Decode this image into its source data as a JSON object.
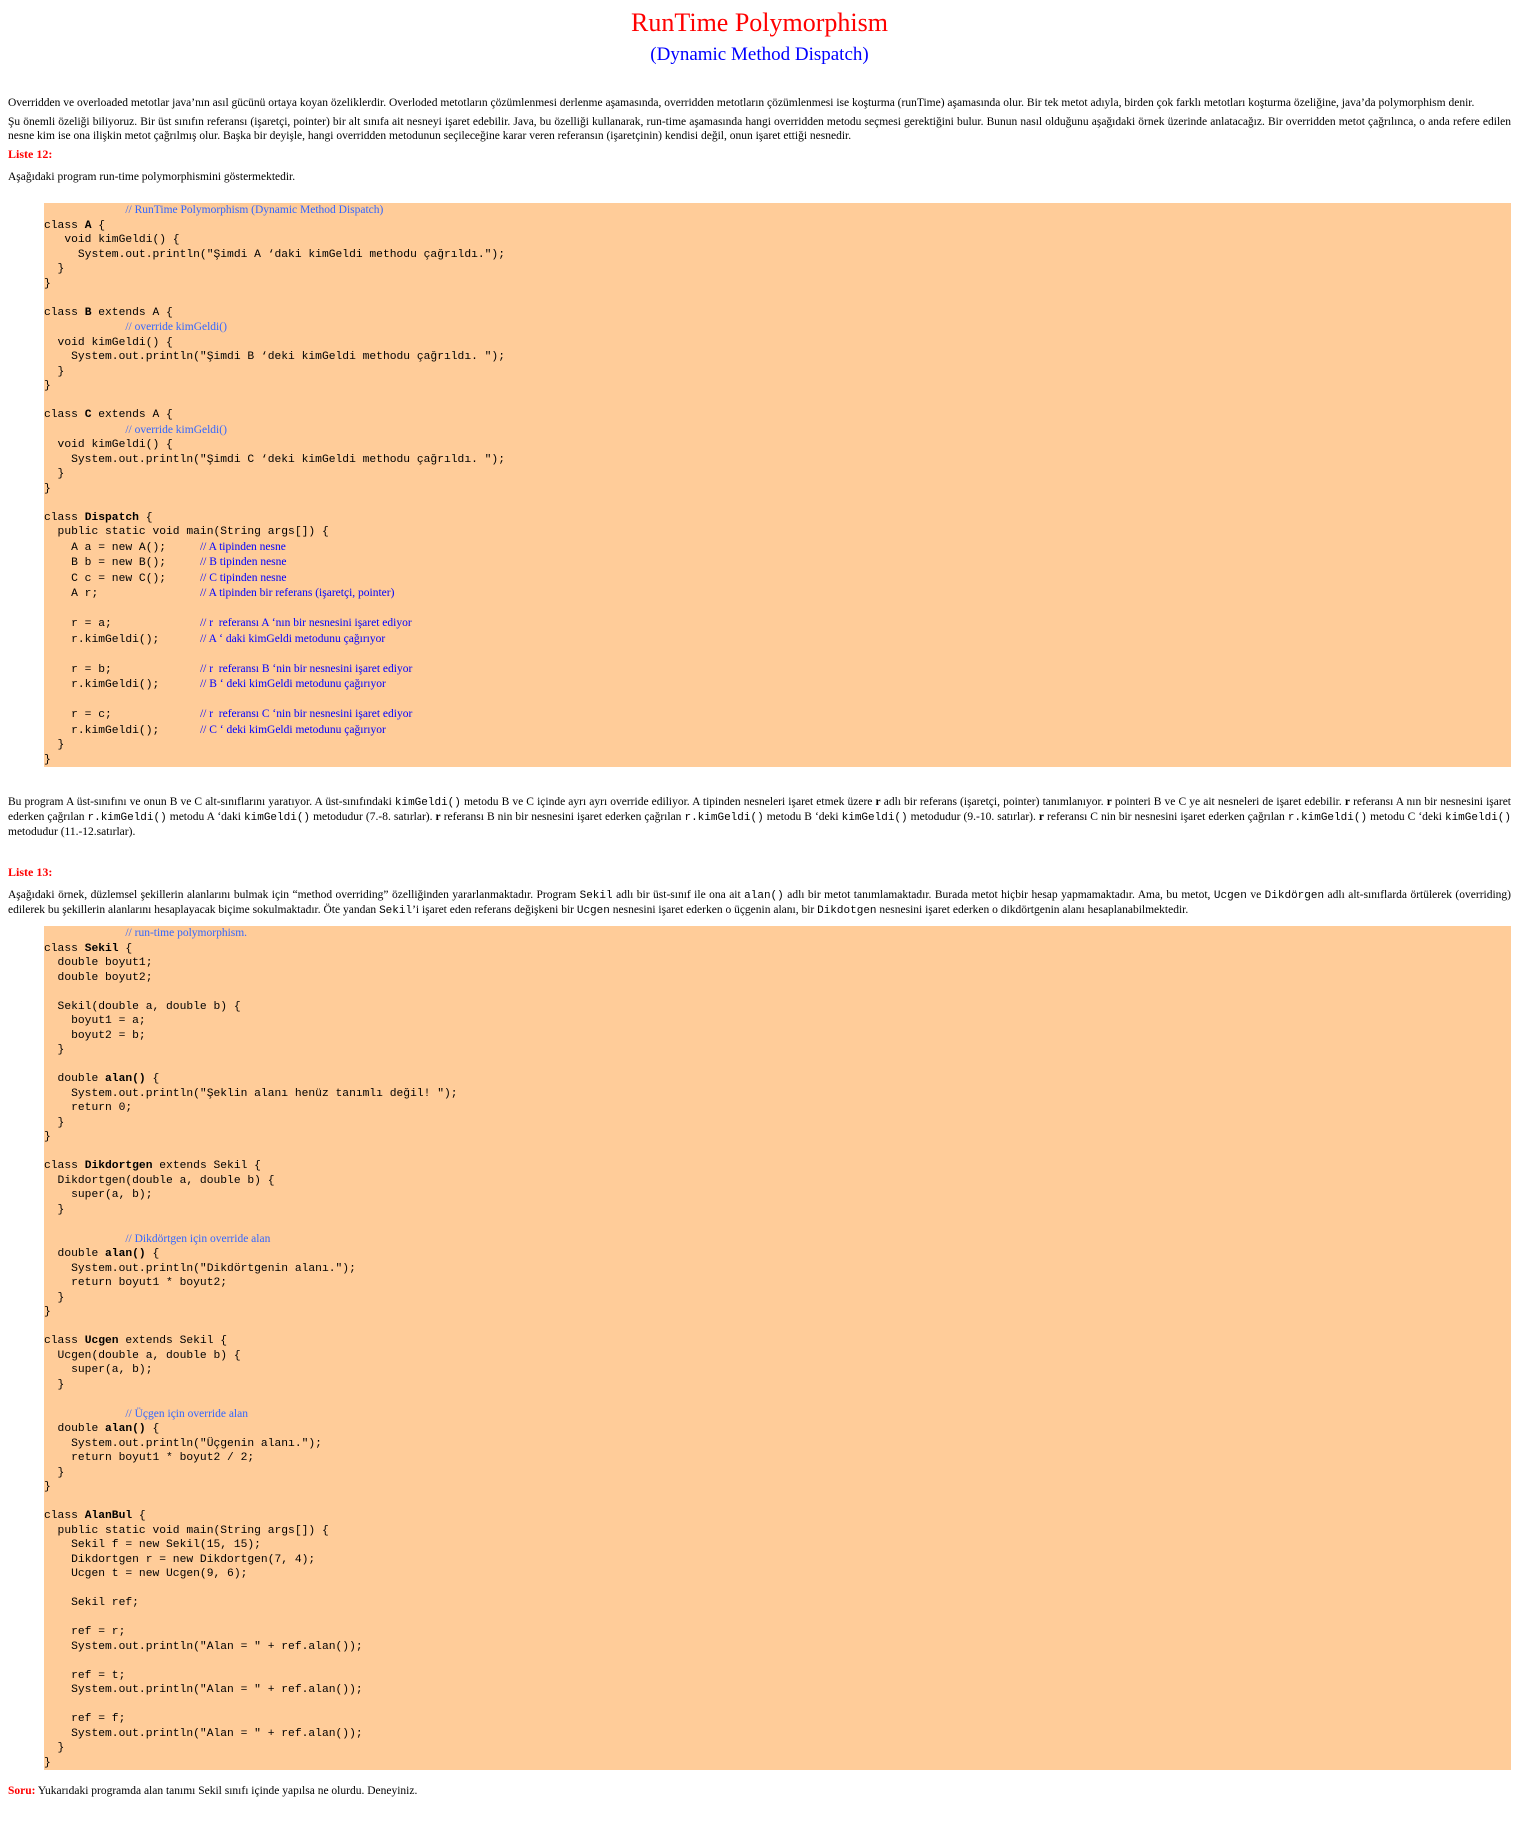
{
  "title": "RunTime Polymorphism",
  "subtitle": "(Dynamic Method Dispatch)",
  "intro": {
    "p1": "Overridden ve overloaded metotlar java’nın asıl gücünü ortaya koyan özeliklerdir. Overloded metotların çözümlenmesi derlenme aşamasında,  overridden metotların çözümlenmesi ise koşturma (runTime) aşamasında olur. Bir tek metot adıyla, birden çok farklı  metotları koşturma özeliğine, java’da polymorphism denir.",
    "p2": "Şu önemli özeliği biliyoruz. Bir üst sınıfın referansı (işaretçi, pointer) bir alt sınıfa ait nesneyi işaret edebilir. Java, bu özelliği kullanarak, run-time aşamasında hangi overridden metodu seçmesi gerektiğini bulur. Bunun nasıl olduğunu aşağıdaki örnek üzerinde anlatacağız. Bir overridden metot çağrılınca, o anda refere edilen nesne kim ise ona ilişkin metot çağrılmış olur. Başka bir deyişle, hangi overridden metodunun seçileceğine karar veren referansın (işaretçinin) kendisi değil, onun işaret ettiği nesnedir."
  },
  "liste12": {
    "label": "Liste 12:",
    "desc": "Aşağıdaki program run-time polymorphismini göstermektedir.",
    "header_comment": "// RunTime Polymorphism (Dynamic Method Dispatch)",
    "override_comment": "// override kimGeldi()",
    "main_comments": [
      "// A tipinden nesne",
      "// B tipinden nesne",
      "// C tipinden nesne",
      "// A tipinden bir referans (işaretçi, pointer)",
      "// r  referansı A ‘nın bir nesnesini işaret ediyor",
      "// A ‘ daki kimGeldi metodunu çağırıyor",
      "// r  referansı B ‘nin bir nesnesini işaret ediyor",
      "// B ‘ deki kimGeldi metodunu çağırıyor",
      "// r  referansı C ‘nin bir nesnesini işaret ediyor",
      "// C ‘ deki kimGeldi metodunu çağırıyor"
    ]
  },
  "explain12": {
    "t1": "Bu program A üst-sınıfını ve onun B ve C alt-sınıflarını yaratıyor. A üst-sınıfındaki ",
    "c1": "kimGeldi()",
    "t2": " metodu B ve C içinde ayrı ayrı override ediliyor. A tipinden nesneleri işaret etmek üzere ",
    "b1": "r",
    "t3": " adlı bir referans (işaretçi, pointer) tanımlanıyor. ",
    "b2": "r",
    "t4": " pointeri B ve C ye ait nesneleri de işaret edebilir. ",
    "b3": "r",
    "t5": " referansı A nın bir nesnesini işaret ederken çağrılan ",
    "c2": "r.kimGeldi()",
    "t6": " metodu A ‘daki ",
    "c3": "kimGeldi()",
    "t7": " metodudur (7.-8. satırlar). ",
    "b4": "r",
    "t8": " referansı B nin bir nesnesini işaret ederken çağrılan ",
    "c4": "r.kimGeldi()",
    "t9": " metodu B ‘deki ",
    "c5": "kimGeldi()",
    "t10": " metodudur (9.-10. satırlar). ",
    "b5": "r",
    "t11": " referansı C nin bir nesnesini işaret ederken çağrılan ",
    "c6": "r.kimGeldi()",
    "t12": " metodu C ‘deki  ",
    "c7": "kimGeldi()",
    "t13": " metodudur (11.-12.satırlar)."
  },
  "liste13": {
    "label": "Liste 13:",
    "d1": "Aşağıdaki örnek, düzlemsel şekillerin alanlarını bulmak için “method overriding” özelliğinden yararlanmaktadır. Program ",
    "dc1": "Sekil",
    "d2": " adlı bir üst-sınıf  ile ona ait ",
    "dc2": "alan()",
    "d3": " adlı bir metot tanımlamaktadır. Burada metot hiçbir hesap yapmamaktadır. Ama, bu metot, ",
    "dc3": "Ucgen",
    "d4": " ve ",
    "dc4": "Dikdörgen",
    "d5": " adlı alt-sınıflarda örtülerek (overriding) edilerek bu şekillerin alanlarını hesaplayacak biçime sokulmaktadır. Öte  yandan ",
    "dc5": "Sekil",
    "d6": "’i işaret eden referans değişkeni bir  ",
    "dc6": "Ucgen",
    "d7": " nesnesini işaret ederken o üçgenin alanı, bir ",
    "dc7": "Dikdotgen",
    "d8": " nesnesini işaret ederken o dikdörtgenin alanı hesaplanabilmektedir.",
    "header_comment": "// run-time polymorphism.",
    "dik_comment": "// Dikdörtgen için override alan",
    "ucgen_comment": "// Üçgen için override alan"
  },
  "soru": {
    "label": "Soru:",
    "text": " Yukarıdaki programda alan tanımı Sekil sınıfı içinde yapılsa ne olurdu. Deneyiniz."
  }
}
